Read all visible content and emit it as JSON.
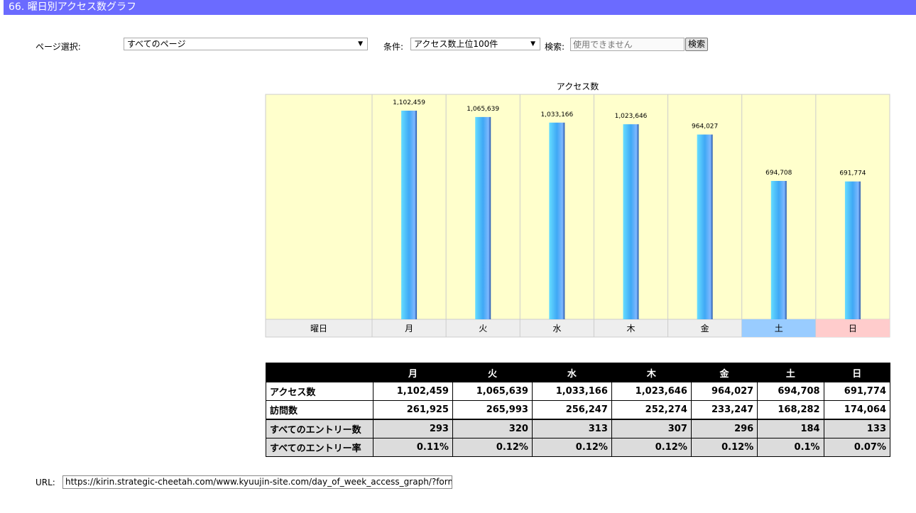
{
  "title": "66. 曜日別アクセス数グラフ",
  "controls": {
    "page_label": "ページ選択:",
    "page_value": "すべてのページ",
    "cond_label": "条件:",
    "cond_value": "アクセス数上位100件",
    "search_label": "検索:",
    "search_placeholder": "使用できません",
    "search_button": "検索"
  },
  "chart_data": {
    "type": "bar",
    "title": "アクセス数",
    "xlabel": "曜日",
    "categories": [
      "月",
      "火",
      "水",
      "木",
      "金",
      "土",
      "日"
    ],
    "values": [
      1102459,
      1065639,
      1033166,
      1023646,
      964027,
      694708,
      691774
    ],
    "value_labels": [
      "1,102,459",
      "1,065,639",
      "1,033,166",
      "1,023,646",
      "964,027",
      "694,708",
      "691,774"
    ],
    "ylim": [
      -108000,
      1197000
    ],
    "grid": false,
    "colors": {
      "plot_bg": "#ffffcc",
      "saturday": "#99ccff",
      "sunday": "#ffcccc",
      "axis_bg": "#eeeeee",
      "bar": "#4fb5ff"
    }
  },
  "table": {
    "headers": [
      "",
      "月",
      "火",
      "水",
      "木",
      "金",
      "土",
      "日"
    ],
    "rows": [
      {
        "label": "アクセス数",
        "values": [
          "1,102,459",
          "1,065,639",
          "1,033,166",
          "1,023,646",
          "964,027",
          "694,708",
          "691,774"
        ]
      },
      {
        "label": "訪問数",
        "values": [
          "261,925",
          "265,993",
          "256,247",
          "252,274",
          "233,247",
          "168,282",
          "174,064"
        ]
      },
      {
        "label": "すべてのエントリー数",
        "values": [
          "293",
          "320",
          "313",
          "307",
          "296",
          "184",
          "133"
        ]
      },
      {
        "label": "すべてのエントリー率",
        "values": [
          "0.11%",
          "0.12%",
          "0.12%",
          "0.12%",
          "0.12%",
          "0.1%",
          "0.07%"
        ]
      }
    ]
  },
  "url": {
    "label": "URL:",
    "value": "https://kirin.strategic-cheetah.com/www.kyuujin-site.com/day_of_week_access_graph/?format"
  }
}
